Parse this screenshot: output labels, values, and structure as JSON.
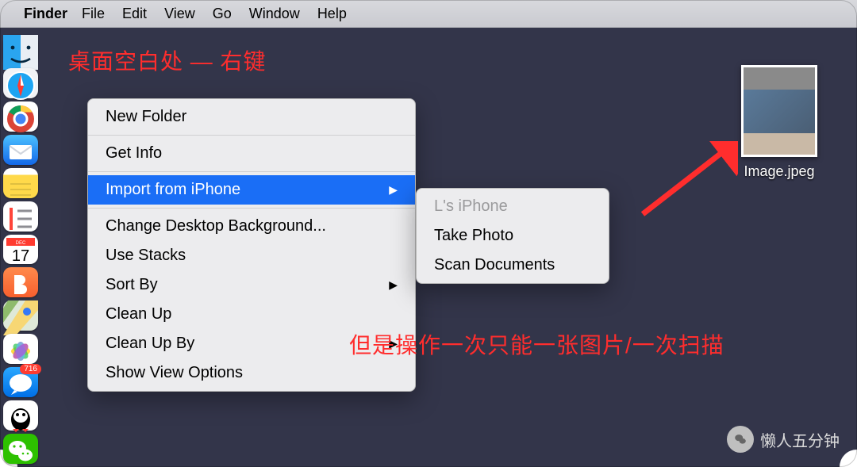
{
  "menubar": {
    "app": "Finder",
    "items": [
      "File",
      "Edit",
      "View",
      "Go",
      "Window",
      "Help"
    ]
  },
  "dock": [
    {
      "name": "finder",
      "bg": "#1e9df1"
    },
    {
      "name": "safari",
      "bg": "#f4f4f6"
    },
    {
      "name": "chrome",
      "bg": "#ffffff"
    },
    {
      "name": "mail",
      "bg": "#1f8bf3"
    },
    {
      "name": "notes",
      "bg": "#ffd94a"
    },
    {
      "name": "reminders",
      "bg": "#ffffff"
    },
    {
      "name": "calendar",
      "bg": "#ffffff"
    },
    {
      "name": "reader",
      "bg": "#fb6d3a"
    },
    {
      "name": "maps",
      "bg": "#e9efe2"
    },
    {
      "name": "photos",
      "bg": "#ffffff"
    },
    {
      "name": "messages",
      "bg": "#0a84ff"
    },
    {
      "name": "qq",
      "bg": "#ffffff"
    },
    {
      "name": "wechat",
      "bg": "#2dc100"
    }
  ],
  "context_menu": {
    "items": [
      {
        "label": "New Folder"
      },
      {
        "sep": true
      },
      {
        "label": "Get Info"
      },
      {
        "sep": true
      },
      {
        "label": "Import from iPhone",
        "submenu": true,
        "selected": true
      },
      {
        "sep": true
      },
      {
        "label": "Change Desktop Background..."
      },
      {
        "label": "Use Stacks"
      },
      {
        "label": "Sort By",
        "submenu": true
      },
      {
        "label": "Clean Up"
      },
      {
        "label": "Clean Up By",
        "submenu": true
      },
      {
        "label": "Show View Options"
      }
    ]
  },
  "submenu": {
    "items": [
      {
        "label": "L's iPhone",
        "disabled": true
      },
      {
        "label": "Take Photo"
      },
      {
        "label": "Scan Documents"
      }
    ]
  },
  "desktop_file": {
    "name": "Image.jpeg"
  },
  "annotations": {
    "top": "桌面空白处 — 右键",
    "mid": "但是操作一次只能一张图片/一次扫描"
  },
  "watermark": "懒人五分钟",
  "calendar_badge": "17",
  "messages_badge": "716"
}
